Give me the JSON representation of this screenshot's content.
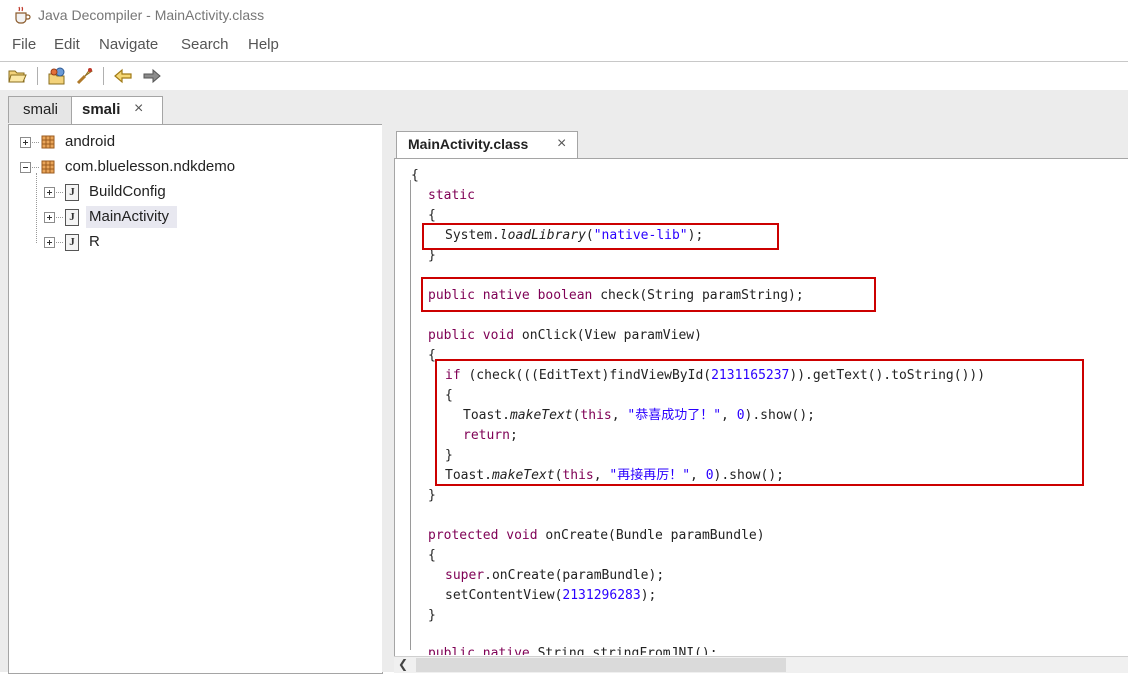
{
  "window": {
    "title": "Java Decompiler - MainActivity.class"
  },
  "menu": [
    "File",
    "Edit",
    "Navigate",
    "Search",
    "Help"
  ],
  "toolbar": {
    "buttons": [
      "open-folder-icon",
      "open-type-icon",
      "search-icon",
      "back-icon",
      "forward-icon"
    ]
  },
  "left_tabs": [
    {
      "label": "smali",
      "active": false
    },
    {
      "label": "smali",
      "active": true,
      "close": "×"
    }
  ],
  "tree": {
    "nodes": [
      {
        "label": "android",
        "icon": "package-icon",
        "expanded": false
      },
      {
        "label": "com.bluelesson.ndkdemo",
        "icon": "package-icon",
        "expanded": true
      },
      {
        "label": "BuildConfig",
        "icon": "class-icon",
        "expanded": false
      },
      {
        "label": "MainActivity",
        "icon": "class-icon",
        "expanded": false,
        "selected": true
      },
      {
        "label": "R",
        "icon": "class-icon",
        "expanded": false
      }
    ],
    "class_icon_glyph": "J"
  },
  "editor": {
    "tab": {
      "label": "MainActivity.class",
      "close": "×"
    },
    "code": {
      "l1": "{",
      "l2": "static",
      "l3": "{",
      "l4a": "System.",
      "l4b": "loadLibrary",
      "l4c": "(",
      "l4d": "\"native-lib\"",
      "l4e": ");",
      "l5": "}",
      "l6a": "public native boolean",
      "l6b": " check(String paramString);",
      "l7a": "public void",
      "l7b": " onClick(View paramView)",
      "l8": "{",
      "l9a": "if",
      "l9b": " (check(((EditText)findViewById(",
      "l9c": "2131165237",
      "l9d": ")).getText().toString()))",
      "l10": "{",
      "l11a": "Toast.",
      "l11b": "makeText",
      "l11c": "(",
      "l11d": "this",
      "l11e": ", ",
      "l11f": "\"恭喜成功了！\"",
      "l11g": ", ",
      "l11h": "0",
      "l11i": ").show();",
      "l12a": "return",
      "l12b": ";",
      "l13": "}",
      "l14a": "Toast.",
      "l14b": "makeText",
      "l14c": "(",
      "l14d": "this",
      "l14e": ", ",
      "l14f": "\"再接再厉！\"",
      "l14g": ", ",
      "l14h": "0",
      "l14i": ").show();",
      "l15": "}",
      "l16a": "protected void",
      "l16b": " onCreate(Bundle paramBundle)",
      "l17": "{",
      "l18a": "super",
      "l18b": ".onCreate(paramBundle);",
      "l19a": "setContentView(",
      "l19b": "2131296283",
      "l19c": ");",
      "l20": "}",
      "l21a": "public native",
      "l21b": " String stringFromJNI();"
    }
  },
  "colors": {
    "keyword": "#7f0055",
    "string": "#2a00ff",
    "highlight_box": "#cc0000"
  }
}
